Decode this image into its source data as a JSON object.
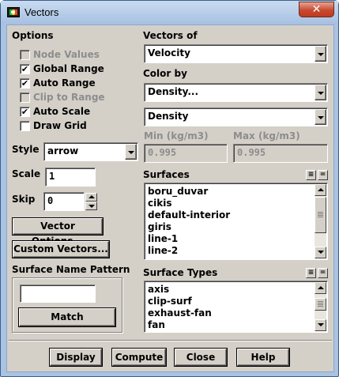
{
  "window": {
    "title": "Vectors",
    "close_glyph": "✕"
  },
  "options": {
    "heading": "Options",
    "items": [
      {
        "label": "Node Values",
        "checked": false,
        "enabled": false
      },
      {
        "label": "Global Range",
        "checked": true,
        "enabled": true
      },
      {
        "label": "Auto Range",
        "checked": true,
        "enabled": true
      },
      {
        "label": "Clip to Range",
        "checked": false,
        "enabled": false
      },
      {
        "label": "Auto Scale",
        "checked": true,
        "enabled": true
      },
      {
        "label": "Draw Grid",
        "checked": false,
        "enabled": true
      }
    ],
    "check_glyph": "✔"
  },
  "style": {
    "label": "Style",
    "value": "arrow"
  },
  "scale": {
    "label": "Scale",
    "value": "1"
  },
  "skip": {
    "label": "Skip",
    "value": "0"
  },
  "buttons": {
    "vector_options": "Vector Options...",
    "custom_vectors": "Custom Vectors...",
    "match": "Match",
    "display": "Display",
    "compute": "Compute",
    "close": "Close",
    "help": "Help"
  },
  "surface_name_pattern": {
    "label": "Surface Name Pattern",
    "value": ""
  },
  "vectors_of": {
    "label": "Vectors of",
    "value": "Velocity"
  },
  "color_by": {
    "label": "Color by",
    "category": "Density...",
    "quantity": "Density"
  },
  "range": {
    "min_label": "Min (kg/m3)",
    "min_value": "0.995",
    "max_label": "Max (kg/m3)",
    "max_value": "0.995"
  },
  "surfaces": {
    "label": "Surfaces",
    "items": [
      "boru_duvar",
      "cikis",
      "default-interior",
      "giris",
      "line-1",
      "line-2"
    ]
  },
  "surface_types": {
    "label": "Surface Types",
    "items": [
      "axis",
      "clip-surf",
      "exhaust-fan",
      "fan"
    ]
  },
  "list_buttons": {
    "select_all": "≡",
    "deselect_all": "="
  }
}
